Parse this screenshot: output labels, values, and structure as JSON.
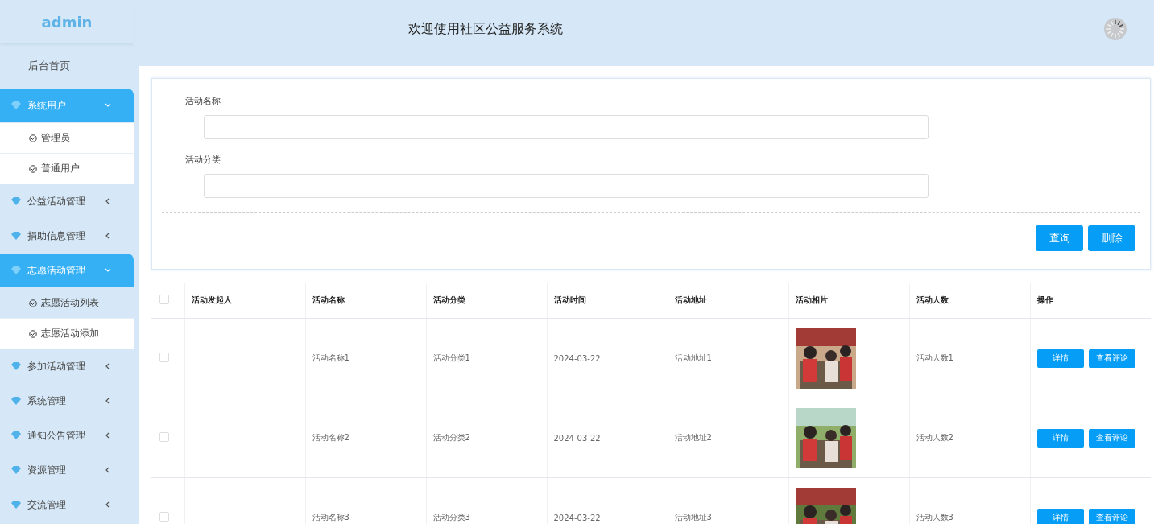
{
  "sidebar": {
    "title": "admin",
    "items": [
      {
        "kind": "link",
        "label": "后台首页"
      },
      {
        "kind": "group",
        "label": "系统用户",
        "expanded": true,
        "children": [
          {
            "label": "管理员",
            "selected": false
          },
          {
            "label": "普通用户",
            "selected": false
          }
        ]
      },
      {
        "kind": "group",
        "label": "公益活动管理",
        "expanded": false
      },
      {
        "kind": "group",
        "label": "捐助信息管理",
        "expanded": false
      },
      {
        "kind": "group",
        "label": "志愿活动管理",
        "expanded": true,
        "children": [
          {
            "label": "志愿活动列表",
            "selected": true
          },
          {
            "label": "志愿活动添加",
            "selected": false
          }
        ]
      },
      {
        "kind": "group",
        "label": "参加活动管理",
        "expanded": false
      },
      {
        "kind": "group",
        "label": "系统管理",
        "expanded": false
      },
      {
        "kind": "group",
        "label": "通知公告管理",
        "expanded": false
      },
      {
        "kind": "group",
        "label": "资源管理",
        "expanded": false
      },
      {
        "kind": "group",
        "label": "交流管理",
        "expanded": false
      }
    ]
  },
  "header": {
    "title": "欢迎使用社区公益服务系统"
  },
  "search_form": {
    "fields": [
      {
        "label": "活动名称"
      },
      {
        "label": "活动分类"
      }
    ],
    "buttons": [
      "查询",
      "删除"
    ]
  },
  "table": {
    "select_all_checked": false,
    "columns": [
      "活动发起人",
      "活动名称",
      "活动分类",
      "活动时间",
      "活动地址",
      "活动相片",
      "活动人数",
      "操作"
    ],
    "rows": [
      {
        "checked": false,
        "cells": [
          "",
          "活动名称1",
          "活动分类1",
          "2024-03-22",
          "活动地址1",
          {
            "kind": "picture"
          },
          "活动人数1"
        ],
        "actions": [
          "详情",
          "查看评论"
        ]
      },
      {
        "checked": false,
        "cells": [
          "",
          "活动名称2",
          "活动分类2",
          "2024-03-22",
          "活动地址2",
          {
            "kind": "picture"
          },
          "活动人数2"
        ],
        "actions": [
          "详情",
          "查看评论"
        ]
      },
      {
        "checked": false,
        "cells": [
          "",
          "活动名称3",
          "活动分类3",
          "2024-03-22",
          "活动地址3",
          {
            "kind": "picture"
          },
          "活动人数3"
        ],
        "actions": [
          "详情",
          "查看评论"
        ]
      }
    ]
  }
}
